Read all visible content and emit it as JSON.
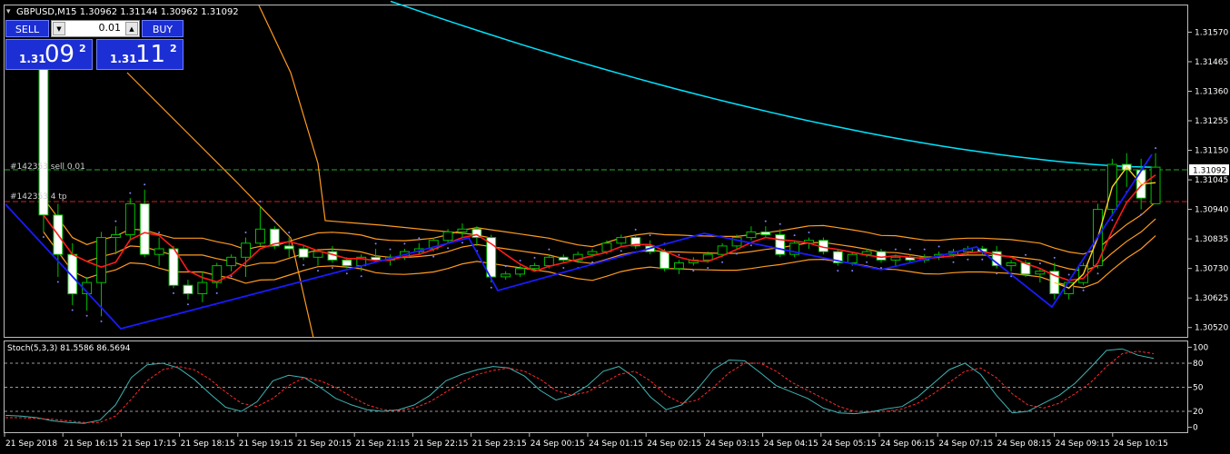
{
  "header": {
    "symbol_line": "GBPUSD,M15  1.30962 1.31144 1.30962 1.31092"
  },
  "trade_panel": {
    "sell_label": "SELL",
    "buy_label": "BUY",
    "lot_value": "0.01",
    "sell_price_prefix": "1.31",
    "sell_price_big": "09",
    "sell_price_sup": "2",
    "buy_price_prefix": "1.31",
    "buy_price_big": "11",
    "buy_price_sup": "2"
  },
  "order_labels": {
    "sell_order": "#142353   sell 0.01",
    "tp_order": "#142353   4 tp"
  },
  "current_price_label": "1.31092",
  "stoch_header": "Stoch(5,3,3) 81.5586 86.5694",
  "colors": {
    "bull": "#00c000",
    "bear": "#ffffff",
    "ma_slow": "#00e5ff",
    "ma_fast": "#ff1a1a",
    "ma_mid": "#ffd21e",
    "envelope": "#ff9a1e",
    "zigzag": "#1a1aff",
    "sar": "#8080ff",
    "stoch_main": "#3fb3b3",
    "stoch_signal": "#ff2a2a",
    "grid": "#9a9a9a"
  },
  "chart_data": [
    {
      "type": "candlestick",
      "title": "GBPUSD,M15",
      "y_axis_ticks": [
        "1.31570",
        "1.31465",
        "1.31360",
        "1.31255",
        "1.31150",
        "1.31045",
        "1.30940",
        "1.30835",
        "1.30730",
        "1.30625",
        "1.30520"
      ],
      "ylim": [
        1.3049,
        1.31665
      ],
      "x_tick_labels": [
        "21 Sep 2018",
        "21 Sep 16:15",
        "21 Sep 17:15",
        "21 Sep 18:15",
        "21 Sep 19:15",
        "21 Sep 20:15",
        "21 Sep 21:15",
        "21 Sep 22:15",
        "21 Sep 23:15",
        "24 Sep 00:15",
        "24 Sep 01:15",
        "24 Sep 02:15",
        "24 Sep 03:15",
        "24 Sep 04:15",
        "24 Sep 05:15",
        "24 Sep 06:15",
        "24 Sep 07:15",
        "24 Sep 08:15",
        "24 Sep 09:15",
        "24 Sep 10:15"
      ],
      "candles": [
        [
          1.3147,
          1.3152,
          1.3086,
          1.3092
        ],
        [
          1.3092,
          1.3096,
          1.307,
          1.3078
        ],
        [
          1.3078,
          1.3082,
          1.306,
          1.3064
        ],
        [
          1.3064,
          1.307,
          1.3058,
          1.3068
        ],
        [
          1.3068,
          1.3086,
          1.3056,
          1.3084
        ],
        [
          1.3084,
          1.3088,
          1.3078,
          1.3085
        ],
        [
          1.3085,
          1.3098,
          1.3083,
          1.3096
        ],
        [
          1.3096,
          1.3101,
          1.3077,
          1.3078
        ],
        [
          1.3078,
          1.3084,
          1.3074,
          1.308
        ],
        [
          1.308,
          1.3081,
          1.3066,
          1.3067
        ],
        [
          1.3067,
          1.3069,
          1.3062,
          1.3064
        ],
        [
          1.3064,
          1.3072,
          1.3061,
          1.3068
        ],
        [
          1.3068,
          1.3075,
          1.3066,
          1.3074
        ],
        [
          1.3074,
          1.3078,
          1.3072,
          1.3077
        ],
        [
          1.3077,
          1.3084,
          1.307,
          1.3082
        ],
        [
          1.3082,
          1.3095,
          1.3081,
          1.3087
        ],
        [
          1.3087,
          1.3088,
          1.308,
          1.3081
        ],
        [
          1.3081,
          1.3084,
          1.3077,
          1.308
        ],
        [
          1.308,
          1.3081,
          1.3076,
          1.3077
        ],
        [
          1.3077,
          1.308,
          1.3074,
          1.3079
        ],
        [
          1.3079,
          1.3081,
          1.3075,
          1.3076
        ],
        [
          1.3076,
          1.3077,
          1.3073,
          1.3074
        ],
        [
          1.3074,
          1.3078,
          1.3072,
          1.3077
        ],
        [
          1.3077,
          1.308,
          1.3075,
          1.3076
        ],
        [
          1.3076,
          1.3078,
          1.3074,
          1.3077
        ],
        [
          1.3077,
          1.308,
          1.3076,
          1.3079
        ],
        [
          1.3079,
          1.3082,
          1.3078,
          1.308
        ],
        [
          1.308,
          1.3084,
          1.3079,
          1.3083
        ],
        [
          1.3083,
          1.3087,
          1.3082,
          1.3086
        ],
        [
          1.3086,
          1.3089,
          1.3084,
          1.3087
        ],
        [
          1.3087,
          1.3088,
          1.3081,
          1.3084
        ],
        [
          1.3084,
          1.3085,
          1.3068,
          1.307
        ],
        [
          1.307,
          1.3072,
          1.3069,
          1.3071
        ],
        [
          1.3071,
          1.3074,
          1.307,
          1.3073
        ],
        [
          1.3073,
          1.3075,
          1.3072,
          1.3074
        ],
        [
          1.3074,
          1.3078,
          1.3073,
          1.3077
        ],
        [
          1.3077,
          1.3078,
          1.3075,
          1.3076
        ],
        [
          1.3076,
          1.3079,
          1.3075,
          1.3078
        ],
        [
          1.3078,
          1.308,
          1.3077,
          1.3079
        ],
        [
          1.3079,
          1.3083,
          1.3078,
          1.3082
        ],
        [
          1.3082,
          1.3085,
          1.3081,
          1.3084
        ],
        [
          1.3084,
          1.3085,
          1.308,
          1.3081
        ],
        [
          1.3081,
          1.3083,
          1.3078,
          1.3079
        ],
        [
          1.3079,
          1.308,
          1.3072,
          1.3073
        ],
        [
          1.3073,
          1.3076,
          1.3071,
          1.3075
        ],
        [
          1.3075,
          1.3077,
          1.3074,
          1.3076
        ],
        [
          1.3076,
          1.3079,
          1.3075,
          1.3078
        ],
        [
          1.3078,
          1.3082,
          1.3077,
          1.3081
        ],
        [
          1.3081,
          1.3085,
          1.308,
          1.3084
        ],
        [
          1.3084,
          1.3088,
          1.3083,
          1.3086
        ],
        [
          1.3086,
          1.3088,
          1.3084,
          1.3085
        ],
        [
          1.3085,
          1.3087,
          1.3077,
          1.3078
        ],
        [
          1.3078,
          1.3083,
          1.3077,
          1.3082
        ],
        [
          1.3082,
          1.3084,
          1.308,
          1.3083
        ],
        [
          1.3083,
          1.3084,
          1.3078,
          1.3079
        ],
        [
          1.3079,
          1.308,
          1.3074,
          1.3075
        ],
        [
          1.3075,
          1.3079,
          1.3074,
          1.3078
        ],
        [
          1.3078,
          1.308,
          1.3077,
          1.3079
        ],
        [
          1.3079,
          1.308,
          1.3075,
          1.3076
        ],
        [
          1.3076,
          1.3078,
          1.3074,
          1.3077
        ],
        [
          1.3077,
          1.3078,
          1.3075,
          1.3076
        ],
        [
          1.3076,
          1.3078,
          1.3075,
          1.3077
        ],
        [
          1.3077,
          1.3079,
          1.3076,
          1.3078
        ],
        [
          1.3078,
          1.308,
          1.3077,
          1.3079
        ],
        [
          1.3079,
          1.3081,
          1.3078,
          1.308
        ],
        [
          1.308,
          1.3081,
          1.3078,
          1.3079
        ],
        [
          1.3079,
          1.3081,
          1.3073,
          1.3074
        ],
        [
          1.3074,
          1.3076,
          1.3072,
          1.3075
        ],
        [
          1.3075,
          1.3076,
          1.307,
          1.3071
        ],
        [
          1.3071,
          1.3073,
          1.3068,
          1.3072
        ],
        [
          1.3072,
          1.3075,
          1.3062,
          1.3064
        ],
        [
          1.3064,
          1.3069,
          1.3062,
          1.3068
        ],
        [
          1.3068,
          1.3075,
          1.3067,
          1.3074
        ],
        [
          1.3074,
          1.3096,
          1.3073,
          1.3094
        ],
        [
          1.3094,
          1.3112,
          1.3092,
          1.311
        ],
        [
          1.311,
          1.3114,
          1.3102,
          1.3108
        ],
        [
          1.3108,
          1.3112,
          1.3094,
          1.3098
        ],
        [
          1.3096,
          1.3114,
          1.3096,
          1.3109
        ]
      ]
    },
    {
      "type": "line",
      "title": "Stoch(5,3,3)",
      "y_axis_ticks": [
        "100",
        "80",
        "50",
        "20",
        "0"
      ],
      "levels": [
        80,
        50,
        20
      ],
      "ylim": [
        -5,
        105
      ],
      "series": [
        {
          "values": [
            15,
            14,
            12,
            8,
            6,
            5,
            9,
            28,
            62,
            78,
            80,
            74,
            60,
            42,
            25,
            20,
            32,
            58,
            65,
            62,
            50,
            36,
            28,
            22,
            20,
            22,
            28,
            40,
            58,
            66,
            72,
            76,
            74,
            64,
            46,
            34,
            40,
            52,
            70,
            76,
            62,
            38,
            22,
            28,
            48,
            72,
            84,
            83,
            68,
            52,
            44,
            36,
            24,
            18,
            17,
            19,
            23,
            26,
            38,
            55,
            72,
            80,
            66,
            40,
            18,
            20,
            30,
            40,
            55,
            75,
            96,
            98,
            90,
            86
          ]
        },
        {
          "values": [
            12,
            12,
            11,
            10,
            8,
            6,
            6,
            14,
            35,
            58,
            72,
            76,
            72,
            60,
            44,
            30,
            26,
            36,
            52,
            62,
            58,
            50,
            38,
            28,
            22,
            21,
            24,
            32,
            44,
            56,
            66,
            71,
            74,
            70,
            60,
            46,
            40,
            44,
            55,
            66,
            70,
            58,
            40,
            30,
            34,
            50,
            68,
            80,
            80,
            70,
            56,
            46,
            36,
            26,
            20,
            19,
            20,
            23,
            30,
            42,
            56,
            70,
            74,
            62,
            42,
            28,
            24,
            30,
            42,
            56,
            76,
            92,
            95,
            92
          ]
        }
      ]
    }
  ]
}
